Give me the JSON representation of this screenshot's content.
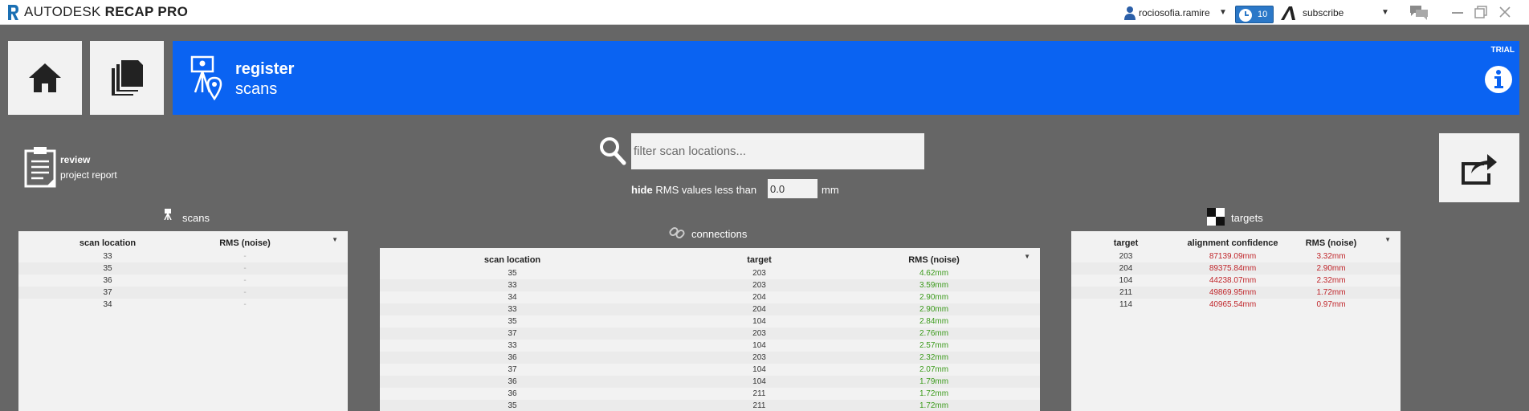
{
  "titlebar": {
    "brand": "AUTODESK",
    "product": "RECAP PRO",
    "user_name": "rociosofia.ramire",
    "notification_count": "10",
    "subscribe_label": "subscribe"
  },
  "banner": {
    "title": "register",
    "subtitle": "scans",
    "badge": "TRIAL",
    "color": "#0a63f2"
  },
  "review": {
    "title": "review",
    "subtitle": "project report"
  },
  "filter": {
    "placeholder": "filter scan locations...",
    "hide_bold": "hide",
    "hide_text": " RMS values less than",
    "rms_value": "0.0",
    "unit": "mm"
  },
  "scans": {
    "label": "scans",
    "columns": [
      "scan location",
      "RMS (noise)"
    ],
    "rows": [
      {
        "location": "33",
        "rms": "-"
      },
      {
        "location": "35",
        "rms": "-"
      },
      {
        "location": "36",
        "rms": "-"
      },
      {
        "location": "37",
        "rms": "-"
      },
      {
        "location": "34",
        "rms": "-"
      }
    ]
  },
  "connections": {
    "label": "connections",
    "columns": [
      "scan location",
      "target",
      "RMS (noise)"
    ],
    "rows": [
      {
        "location": "35",
        "target": "203",
        "rms": "4.62mm"
      },
      {
        "location": "33",
        "target": "203",
        "rms": "3.59mm"
      },
      {
        "location": "34",
        "target": "204",
        "rms": "2.90mm"
      },
      {
        "location": "33",
        "target": "204",
        "rms": "2.90mm"
      },
      {
        "location": "35",
        "target": "104",
        "rms": "2.84mm"
      },
      {
        "location": "37",
        "target": "203",
        "rms": "2.76mm"
      },
      {
        "location": "33",
        "target": "104",
        "rms": "2.57mm"
      },
      {
        "location": "36",
        "target": "203",
        "rms": "2.32mm"
      },
      {
        "location": "37",
        "target": "104",
        "rms": "2.07mm"
      },
      {
        "location": "36",
        "target": "104",
        "rms": "1.79mm"
      },
      {
        "location": "36",
        "target": "211",
        "rms": "1.72mm"
      },
      {
        "location": "35",
        "target": "211",
        "rms": "1.72mm"
      }
    ]
  },
  "targets": {
    "label": "targets",
    "columns": [
      "target",
      "alignment confidence",
      "RMS (noise)"
    ],
    "rows": [
      {
        "target": "203",
        "confidence": "87139.09mm",
        "rms": "3.32mm"
      },
      {
        "target": "204",
        "confidence": "89375.84mm",
        "rms": "2.90mm"
      },
      {
        "target": "104",
        "confidence": "44238.07mm",
        "rms": "2.32mm"
      },
      {
        "target": "211",
        "confidence": "49869.95mm",
        "rms": "1.72mm"
      },
      {
        "target": "114",
        "confidence": "40965.54mm",
        "rms": "0.97mm"
      }
    ]
  }
}
